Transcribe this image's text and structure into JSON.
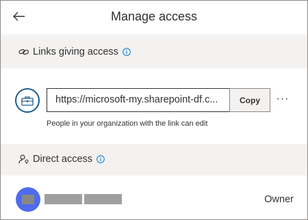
{
  "header": {
    "title": "Manage access",
    "back_icon": "arrow-left-icon"
  },
  "links_section": {
    "label": "Links giving access",
    "icon": "link-icon",
    "info_icon": "info-icon"
  },
  "link": {
    "type_icon": "briefcase-icon",
    "url": "https://microsoft-my.sharepoint-df.c...",
    "copy_label": "Copy",
    "more_label": "···",
    "description": "People in your organization with the link can edit"
  },
  "direct_section": {
    "label": "Direct access",
    "icon": "person-key-icon",
    "info_icon": "info-icon"
  },
  "people": [
    {
      "role": "Owner"
    }
  ],
  "colors": {
    "accent": "#0078d4",
    "avatar": "#4f6bed",
    "band": "#f3f2f1"
  }
}
